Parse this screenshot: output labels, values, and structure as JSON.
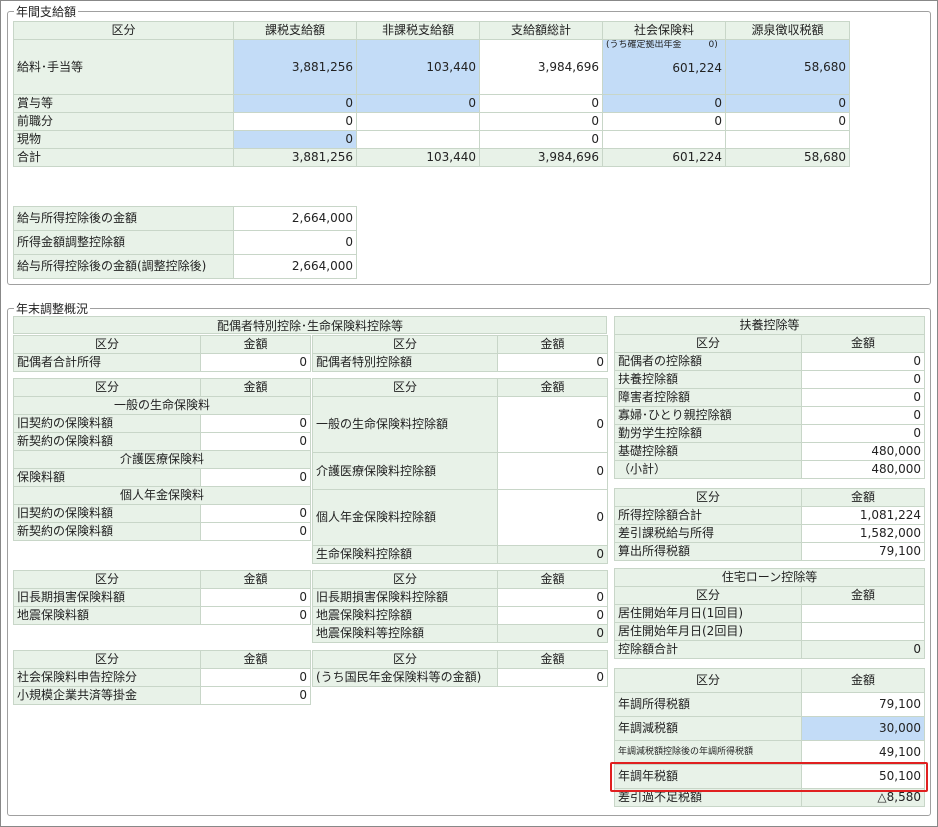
{
  "annual": {
    "legend": "年間支給額",
    "headers": [
      "区分",
      "課税支給額",
      "非課税支給額",
      "支給額総計",
      "社会保険料",
      "源泉徴収税額"
    ],
    "rows": [
      {
        "label": "給料･手当等",
        "taxable": "3,881,256",
        "nontax": "103,440",
        "total": "3,984,696",
        "social_note": "(うち確定拠出年金　　　0)",
        "social": "601,224",
        "withholding": "58,680"
      },
      {
        "label": "賞与等",
        "taxable": "0",
        "nontax": "0",
        "total": "0",
        "social": "0",
        "withholding": "0"
      },
      {
        "label": "前職分",
        "taxable": "0",
        "nontax": "",
        "total": "0",
        "social": "0",
        "withholding": "0"
      },
      {
        "label": "現物",
        "taxable": "0",
        "nontax": "",
        "total": "0",
        "social": "",
        "withholding": ""
      },
      {
        "label": "合計",
        "taxable": "3,881,256",
        "nontax": "103,440",
        "total": "3,984,696",
        "social": "601,224",
        "withholding": "58,680"
      }
    ],
    "deductions": [
      {
        "label": "給与所得控除後の金額",
        "value": "2,664,000"
      },
      {
        "label": "所得金額調整控除額",
        "value": "0"
      },
      {
        "label": "給与所得控除後の金額(調整控除後)",
        "value": "2,664,000"
      }
    ]
  },
  "yearend": {
    "legend": "年末調整概況",
    "kubun": "区分",
    "kingaku": "金額",
    "spouse_title": "配偶者特別控除･生命保険料控除等",
    "spouse_income_label": "配偶者合計所得",
    "spouse_income": "0",
    "spouse_special_label": "配偶者特別控除額",
    "spouse_special": "0",
    "life_general_title": "一般の生命保険料",
    "old_contract": "旧契約の保険料額",
    "new_contract": "新契約の保険料額",
    "life_general_old": "0",
    "life_general_new": "0",
    "life_general_deduct_label": "一般の生命保険料控除額",
    "life_general_deduct": "0",
    "care_title": "介護医療保険料",
    "care_premium_label": "保険料額",
    "care_premium": "0",
    "care_deduct_label": "介護医療保険料控除額",
    "care_deduct": "0",
    "pension_title": "個人年金保険料",
    "pension_old": "0",
    "pension_new": "0",
    "pension_deduct_label": "個人年金保険料控除額",
    "pension_deduct": "0",
    "life_total_label": "生命保険料控除額",
    "life_total": "0",
    "old_longterm_label": "旧長期損害保険料額",
    "old_longterm": "0",
    "quake_label": "地震保険料額",
    "quake": "0",
    "old_longterm_deduct_label": "旧長期損害保険料控除額",
    "old_longterm_deduct": "0",
    "quake_deduct_label": "地震保険料控除額",
    "quake_deduct": "0",
    "quake_total_label": "地震保険料等控除額",
    "quake_total": "0",
    "social_decl_label": "社会保険料申告控除分",
    "social_decl": "0",
    "small_biz_label": "小規模企業共済等掛金",
    "small_biz": "0",
    "national_pension_label": "(うち国民年金保険料等の金額)",
    "national_pension": "0",
    "dependents_title": "扶養控除等",
    "dependents": [
      {
        "label": "配偶者の控除額",
        "value": "0"
      },
      {
        "label": "扶養控除額",
        "value": "0"
      },
      {
        "label": "障害者控除額",
        "value": "0"
      },
      {
        "label": "寡婦･ひとり親控除額",
        "value": "0"
      },
      {
        "label": "勤労学生控除額",
        "value": "0"
      },
      {
        "label": "基礎控除額",
        "value": "480,000"
      },
      {
        "label": "（小計）",
        "value": "480,000"
      }
    ],
    "income": [
      {
        "label": "所得控除額合計",
        "value": "1,081,224"
      },
      {
        "label": "差引課税給与所得",
        "value": "1,582,000"
      },
      {
        "label": "算出所得税額",
        "value": "79,100"
      }
    ],
    "housing_title": "住宅ローン控除等",
    "housing": [
      {
        "label": "居住開始年月日(1回目)",
        "value": ""
      },
      {
        "label": "居住開始年月日(2回目)",
        "value": ""
      },
      {
        "label": "控除額合計",
        "value": "0"
      }
    ],
    "final": [
      {
        "label": "年調所得税額",
        "value": "79,100"
      },
      {
        "label": "年調減税額",
        "value": "30,000"
      },
      {
        "label": "年調減税額控除後の年調所得税額",
        "value": "49,100"
      },
      {
        "label": "年調年税額",
        "value": "50,100"
      },
      {
        "label": "差引過不足税額",
        "value": "△8,580"
      }
    ]
  }
}
